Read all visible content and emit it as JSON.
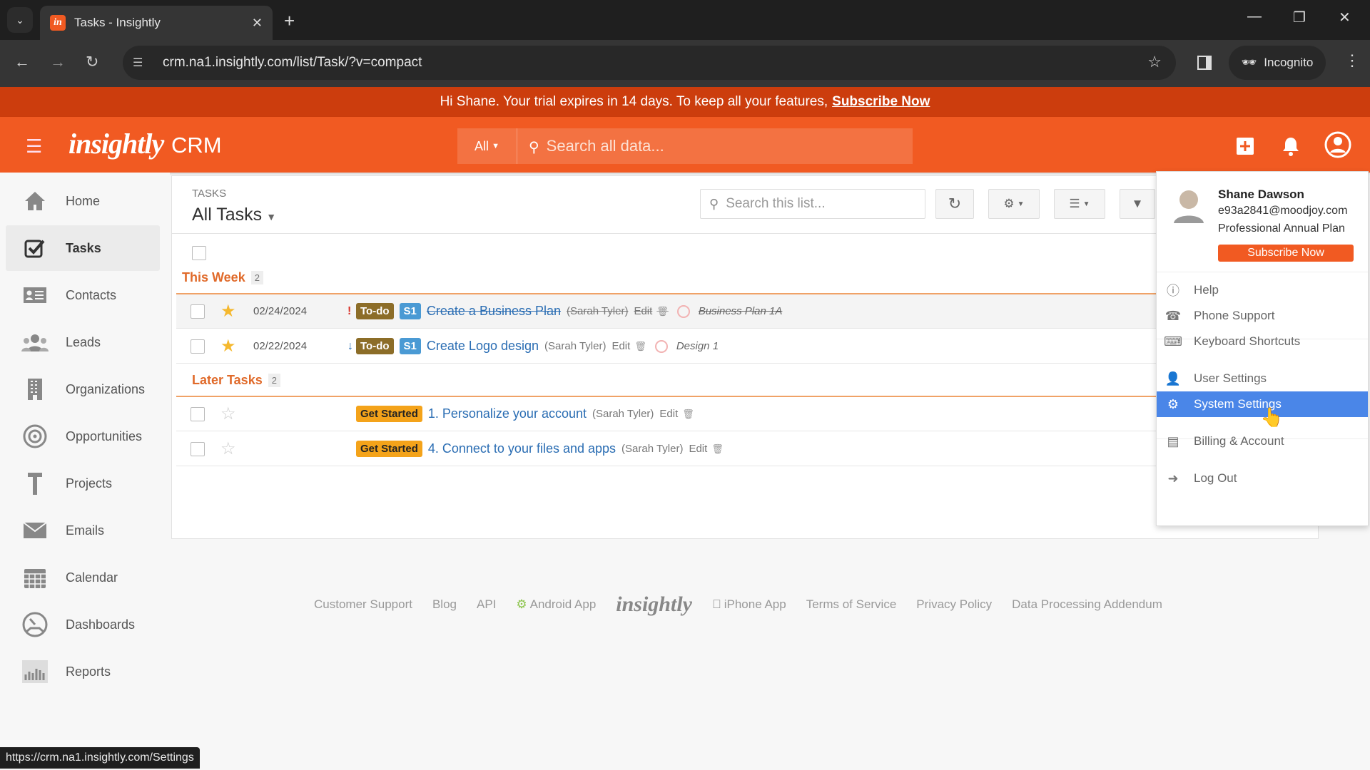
{
  "browser": {
    "tab_title": "Tasks - Insightly",
    "favicon_letter": "in",
    "url": "crm.na1.insightly.com/list/Task/?v=compact",
    "incognito_label": "Incognito",
    "status_url": "https://crm.na1.insightly.com/Settings"
  },
  "banner": {
    "text": "Hi Shane. Your trial expires in 14 days. To keep all your features,",
    "link": "Subscribe Now"
  },
  "header": {
    "logo": "insightly",
    "product": "CRM",
    "search_scope": "All",
    "search_placeholder": "Search all data..."
  },
  "sidebar": {
    "items": [
      {
        "label": "Home",
        "icon": "home-icon"
      },
      {
        "label": "Tasks",
        "icon": "tasks-icon",
        "active": true
      },
      {
        "label": "Contacts",
        "icon": "contacts-icon"
      },
      {
        "label": "Leads",
        "icon": "leads-icon"
      },
      {
        "label": "Organizations",
        "icon": "organizations-icon"
      },
      {
        "label": "Opportunities",
        "icon": "opportunities-icon"
      },
      {
        "label": "Projects",
        "icon": "projects-icon"
      },
      {
        "label": "Emails",
        "icon": "emails-icon"
      },
      {
        "label": "Calendar",
        "icon": "calendar-icon"
      },
      {
        "label": "Dashboards",
        "icon": "dashboards-icon"
      },
      {
        "label": "Reports",
        "icon": "reports-icon"
      }
    ]
  },
  "main": {
    "breadcrumb": "TASKS",
    "view_title": "All Tasks",
    "list_search_placeholder": "Search this list...",
    "groups": [
      {
        "label": "This Week",
        "count": "2",
        "tasks": [
          {
            "starred": true,
            "date": "02/24/2024",
            "priority": "!",
            "status": "To-do",
            "stage": "S1",
            "name": "Create a Business Plan",
            "owner": "(Sarah Tyler)",
            "edit": "Edit",
            "project": "Business Plan 1A",
            "completed": true
          },
          {
            "starred": true,
            "date": "02/22/2024",
            "priority": "↓",
            "status": "To-do",
            "stage": "S1",
            "name": "Create Logo design",
            "owner": "(Sarah Tyler)",
            "edit": "Edit",
            "project": "Design 1",
            "completed": false
          }
        ]
      },
      {
        "label": "Later Tasks",
        "count": "2",
        "tasks": [
          {
            "starred": false,
            "date": "",
            "status": "Get Started",
            "name": "1. Personalize your account",
            "owner": "(Sarah Tyler)",
            "edit": "Edit"
          },
          {
            "starred": false,
            "date": "",
            "status": "Get Started",
            "name": "4. Connect to your files and apps",
            "owner": "(Sarah Tyler)",
            "edit": "Edit"
          }
        ]
      }
    ]
  },
  "footer": {
    "links": [
      "Customer Support",
      "Blog",
      "API",
      "Android App",
      "insightly",
      "iPhone App",
      "Terms of Service",
      "Privacy Policy",
      "Data Processing Addendum"
    ]
  },
  "user_menu": {
    "name": "Shane Dawson",
    "email": "e93a2841@moodjoy.com",
    "plan": "Professional Annual Plan",
    "subscribe": "Subscribe Now",
    "items": [
      {
        "label": "Help",
        "icon": "help-icon"
      },
      {
        "label": "Phone Support",
        "icon": "phone-icon"
      },
      {
        "label": "Keyboard Shortcuts",
        "icon": "keyboard-icon"
      },
      {
        "label": "User Settings",
        "icon": "user-settings-icon"
      },
      {
        "label": "System Settings",
        "icon": "gear-icon",
        "highlighted": true
      },
      {
        "label": "Billing & Account",
        "icon": "credit-card-icon"
      },
      {
        "label": "Log Out",
        "icon": "logout-icon"
      }
    ]
  },
  "colors": {
    "brand": "#f15a22",
    "banner": "#cc3d0d",
    "menu_highlight": "#4a86e8",
    "todo_tag": "#8c6d28",
    "stage_tag": "#4a9ad4",
    "get_started_tag": "#f4a31a",
    "link": "#2a6db3"
  }
}
